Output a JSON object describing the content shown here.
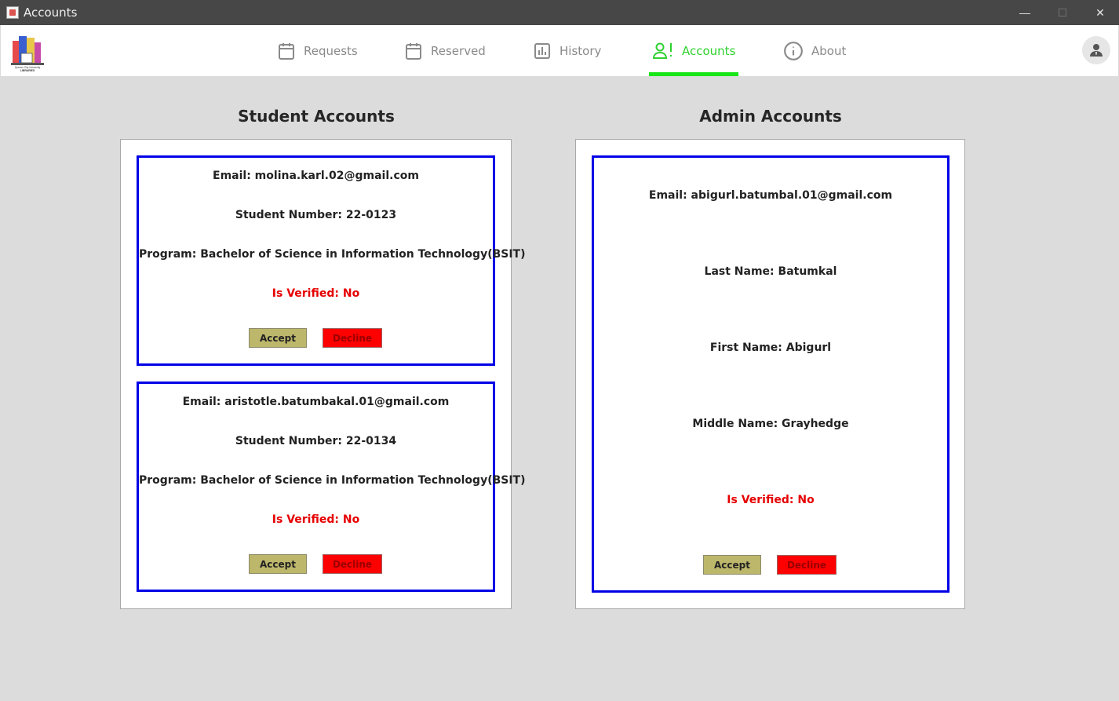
{
  "window": {
    "title": "Accounts",
    "controls": {
      "minimize": "—",
      "maximize": "☐",
      "close": "✕"
    }
  },
  "logo": {
    "text_top": "Quezon City University",
    "text_bottom": "LIBRARIES"
  },
  "nav": {
    "items": [
      {
        "label": "Requests",
        "icon": "calendar-icon"
      },
      {
        "label": "Reserved",
        "icon": "calendar-icon"
      },
      {
        "label": "History",
        "icon": "bar-chart-icon"
      },
      {
        "label": "Accounts",
        "icon": "user-alert-icon",
        "active": true
      },
      {
        "label": "About",
        "icon": "info-icon"
      }
    ],
    "active_color": "#2fd12f"
  },
  "students": {
    "title": "Student Accounts",
    "cards": [
      {
        "email": "Email: molina.karl.02@gmail.com",
        "student_number": "Student Number: 22-0123",
        "program": "Program: Bachelor of Science in Information Technology(BSIT)",
        "verified": "Is Verified: No",
        "accept": "Accept",
        "decline": "Decline"
      },
      {
        "email": "Email: aristotle.batumbakal.01@gmail.com",
        "student_number": "Student Number: 22-0134",
        "program": "Program: Bachelor of Science in Information Technology(BSIT)",
        "verified": "Is Verified: No",
        "accept": "Accept",
        "decline": "Decline"
      }
    ]
  },
  "admins": {
    "title": "Admin Accounts",
    "cards": [
      {
        "email": "Email: abigurl.batumbal.01@gmail.com",
        "last_name": "Last Name: Batumkal",
        "first_name": "First Name: Abigurl",
        "middle_name": "Middle Name: Grayhedge",
        "verified": "Is Verified: No",
        "accept": "Accept",
        "decline": "Decline"
      }
    ]
  },
  "colors": {
    "card_border": "#0000e6",
    "verified_no": "#e60000",
    "accept_bg": "#bdb76b",
    "decline_bg": "#ff0000"
  }
}
